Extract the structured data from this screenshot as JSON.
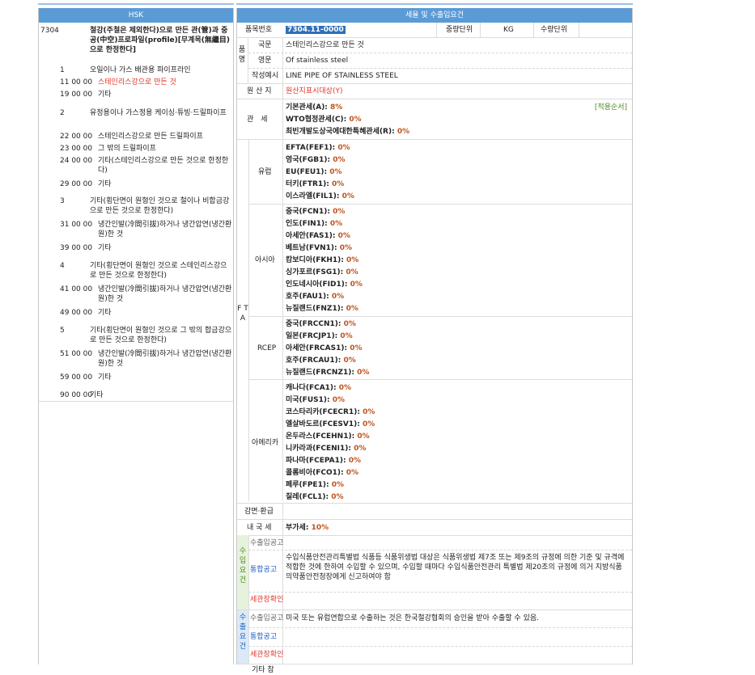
{
  "left_panel": {
    "title": "HSK",
    "heading": {
      "code": "7304",
      "desc": "철강(주철은 제외한다)으로 만든 관(管)과 중공(中空)프로파일(profile)[무계목(無繼目)으로 한정한다]"
    },
    "rows": [
      {
        "code": "1",
        "desc": "오일이나 가스 배관용 파이프라인"
      },
      {
        "code": "11 00 00",
        "desc": "스테인리스강으로 만든 것",
        "highlight": true
      },
      {
        "code": "19 00 00",
        "desc": "기타"
      },
      {
        "code": "2",
        "desc": "유정용이나 가스정용 케이싱·튜빙·드릴파이프"
      },
      {
        "code": "22 00 00",
        "desc": "스테인리스강으로 만든 드릴파이프"
      },
      {
        "code": "23 00 00",
        "desc": "그 밖의 드릴파이프"
      },
      {
        "code": "24 00 00",
        "desc": "기타(스테인리스강으로 만든 것으로 한정한다)"
      },
      {
        "code": "29 00 00",
        "desc": "기타"
      },
      {
        "code": "3",
        "desc": "기타(횡단면이 원형인 것으로 철이나 비합금강으로 만든 것으로 한정한다)"
      },
      {
        "code": "31 00 00",
        "desc": "냉간인발(冷間引拔)하거나 냉간압연(냉간환원)한 것"
      },
      {
        "code": "39 00 00",
        "desc": "기타"
      },
      {
        "code": "4",
        "desc": "기타(횡단면이 원형인 것으로 스테인리스강으로 만든 것으로 한정한다)"
      },
      {
        "code": "41 00 00",
        "desc": "냉간인발(冷間引拔)하거나 냉간압연(냉간환원)한 것"
      },
      {
        "code": "49 00 00",
        "desc": "기타"
      },
      {
        "code": "5",
        "desc": "기타(횡단면이 원형인 것으로 그 밖의 합금강으로 만든 것으로 한정한다)"
      },
      {
        "code": "51 00 00",
        "desc": "냉간인발(冷間引拔)하거나 냉간압연(냉간환원)한 것"
      },
      {
        "code": "59 00 00",
        "desc": "기타"
      },
      {
        "code": "90 00 00",
        "desc": "기타"
      }
    ]
  },
  "right_panel": {
    "title": "세율 및 수출입요건",
    "code_label": "품목번호",
    "code_value": "7304.11-0000",
    "weight_label": "중량단위",
    "weight_value": "KG",
    "qty_label": "수량단위",
    "name_label": "품명",
    "kor_label": "국문",
    "kor_value": "스테인리스강으로 만든 것",
    "eng_label": "영문",
    "eng_value": "Of stainless steel",
    "example_label": "작성예시",
    "example_value": "LINE PIPE OF STAINLESS STEEL",
    "origin_label": "원 산 지",
    "origin_value": "원산지표시대상(Y)",
    "tariff_label": "관　세",
    "apply_order": "[적용순서]",
    "basic": {
      "name": "기본관세(A): ",
      "rate": "8%"
    },
    "wto": {
      "name": "WTO협정관세(C): ",
      "rate": "0%"
    },
    "ldc": {
      "name": "최빈개발도상국에대한특혜관세(R): ",
      "rate": "0%"
    },
    "fta_label": "F T A",
    "fta_groups": [
      {
        "name": "유럽",
        "items": [
          {
            "name": "EFTA(FEF1): ",
            "rate": "0%"
          },
          {
            "name": "영국(FGB1): ",
            "rate": "0%"
          },
          {
            "name": "EU(FEU1): ",
            "rate": "0%"
          },
          {
            "name": "터키(FTR1): ",
            "rate": "0%"
          },
          {
            "name": "이스라엘(FIL1): ",
            "rate": "0%"
          }
        ]
      },
      {
        "name": "아시아",
        "items": [
          {
            "name": "중국(FCN1): ",
            "rate": "0%"
          },
          {
            "name": "인도(FIN1): ",
            "rate": "0%"
          },
          {
            "name": "아세안(FAS1): ",
            "rate": "0%"
          },
          {
            "name": "베트남(FVN1): ",
            "rate": "0%"
          },
          {
            "name": "캄보디아(FKH1): ",
            "rate": "0%"
          },
          {
            "name": "싱가포르(FSG1): ",
            "rate": "0%"
          },
          {
            "name": "인도네시아(FID1): ",
            "rate": "0%"
          },
          {
            "name": "호주(FAU1): ",
            "rate": "0%"
          },
          {
            "name": "뉴질랜드(FNZ1): ",
            "rate": "0%"
          }
        ]
      },
      {
        "name": "RCEP",
        "items": [
          {
            "name": "중국(FRCCN1): ",
            "rate": "0%"
          },
          {
            "name": "일본(FRCJP1): ",
            "rate": "0%"
          },
          {
            "name": "아세안(FRCAS1): ",
            "rate": "0%"
          },
          {
            "name": "호주(FRCAU1): ",
            "rate": "0%"
          },
          {
            "name": "뉴질랜드(FRCNZ1): ",
            "rate": "0%"
          }
        ]
      },
      {
        "name": "아메리카",
        "items": [
          {
            "name": "캐나다(FCA1): ",
            "rate": "0%"
          },
          {
            "name": "미국(FUS1): ",
            "rate": "0%"
          },
          {
            "name": "코스타리카(FCECR1): ",
            "rate": "0%"
          },
          {
            "name": "엘살바도르(FCESV1): ",
            "rate": "0%"
          },
          {
            "name": "온두라스(FCEHN1): ",
            "rate": "0%"
          },
          {
            "name": "니카라과(FCENI1): ",
            "rate": "0%"
          },
          {
            "name": "파나마(FCEPA1): ",
            "rate": "0%"
          },
          {
            "name": "콜롬비아(FCO1): ",
            "rate": "0%"
          },
          {
            "name": "페루(FPE1): ",
            "rate": "0%"
          },
          {
            "name": "칠레(FCL1): ",
            "rate": "0%"
          }
        ]
      }
    ],
    "reduction_label": "감면·환급",
    "domestic_label": "내 국 세",
    "vat": {
      "name": "부가세: ",
      "rate": "10%"
    },
    "import_label": "수입요건",
    "export_label": "수출요건",
    "import_rows": {
      "notice": "수출입공고",
      "integrated": "통합공고",
      "integrated_text": "수입식품안전관리특별법 식품등 식품위생법 대상은 식품위생법 제7조 또는 제9조의 규정에 의한 기준 및 규격에 적합한 것에 한하여 수입할 수 있으며, 수입할 때마다 수입식품안전관리 특별법 제20조의 규정에 의거 지방식품의약품안전청장에게 신고하여야 함",
      "customs": "세관장확인"
    },
    "export_rows": {
      "notice": "수출입공고",
      "notice_text": "미국 또는 유럽연합으로 수출하는 것은 한국철강협회의 승인을 받아 수출할 수 있음.",
      "integrated": "통합공고",
      "customs": "세관장확인"
    },
    "bottom_label": "기타 참"
  },
  "colors": {
    "header": "#5b9bd5",
    "value": "#c0541e",
    "link": "#1f5fc7",
    "alert": "#e0342a",
    "import_bg": "#e7f2dd",
    "export_bg": "#dbe9f8"
  }
}
